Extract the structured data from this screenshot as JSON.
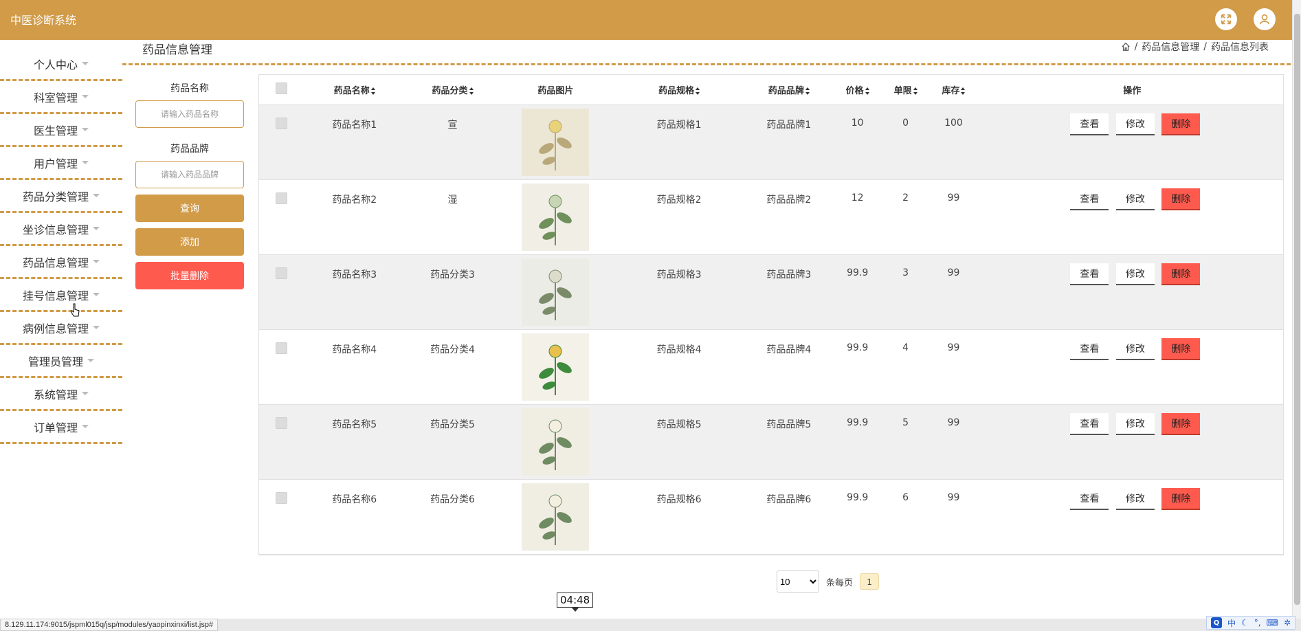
{
  "app": {
    "title": "中医诊断系统"
  },
  "header": {
    "fullscreen_icon": "fullscreen-icon",
    "user_icon": "user-icon"
  },
  "sidebar": {
    "items": [
      {
        "label": "个人中心"
      },
      {
        "label": "科室管理"
      },
      {
        "label": "医生管理"
      },
      {
        "label": "用户管理"
      },
      {
        "label": "药品分类管理"
      },
      {
        "label": "坐诊信息管理"
      },
      {
        "label": "药品信息管理"
      },
      {
        "label": "挂号信息管理"
      },
      {
        "label": "病例信息管理"
      },
      {
        "label": "管理员管理"
      },
      {
        "label": "系统管理"
      },
      {
        "label": "订单管理"
      }
    ]
  },
  "page": {
    "heading": "药品信息管理"
  },
  "breadcrumb": {
    "items": [
      "药品信息管理",
      "药品信息列表"
    ],
    "sep": "/"
  },
  "filter": {
    "name_label": "药品名称",
    "name_placeholder": "请输入药品名称",
    "brand_label": "药品品牌",
    "brand_placeholder": "请输入药品品牌",
    "query_label": "查询",
    "add_label": "添加",
    "batch_delete_label": "批量删除"
  },
  "table": {
    "columns": [
      "药品名称",
      "药品分类",
      "药品图片",
      "药品规格",
      "药品品牌",
      "价格",
      "单限",
      "库存",
      "操作"
    ],
    "rows": [
      {
        "name": "药品名称1",
        "category": "宣",
        "spec": "药品规格1",
        "brand": "药品品牌1",
        "price": "10",
        "limit": "0",
        "stock": "100"
      },
      {
        "name": "药品名称2",
        "category": "湿",
        "spec": "药品规格2",
        "brand": "药品品牌2",
        "price": "12",
        "limit": "2",
        "stock": "99"
      },
      {
        "name": "药品名称3",
        "category": "药品分类3",
        "spec": "药品规格3",
        "brand": "药品品牌3",
        "price": "99.9",
        "limit": "3",
        "stock": "99"
      },
      {
        "name": "药品名称4",
        "category": "药品分类4",
        "spec": "药品规格4",
        "brand": "药品品牌4",
        "price": "99.9",
        "limit": "4",
        "stock": "99"
      },
      {
        "name": "药品名称5",
        "category": "药品分类5",
        "spec": "药品规格5",
        "brand": "药品品牌5",
        "price": "99.9",
        "limit": "5",
        "stock": "99"
      },
      {
        "name": "药品名称6",
        "category": "药品分类6",
        "spec": "药品规格6",
        "brand": "药品品牌6",
        "price": "99.9",
        "limit": "6",
        "stock": "99"
      }
    ],
    "actions": {
      "view": "查看",
      "edit": "修改",
      "delete": "删除"
    }
  },
  "pager": {
    "page_size": "10",
    "per_page_label": "条每页",
    "current_page": "1"
  },
  "tooltip": {
    "time": "04:48"
  },
  "status": {
    "url": "8.129.11.174:9015/jspml015q/jsp/modules/yaopinxinxi/list.jsp#"
  },
  "ime": {
    "mode": "中"
  },
  "colors": {
    "accent": "#d19b48",
    "danger": "#ff5a4e"
  }
}
